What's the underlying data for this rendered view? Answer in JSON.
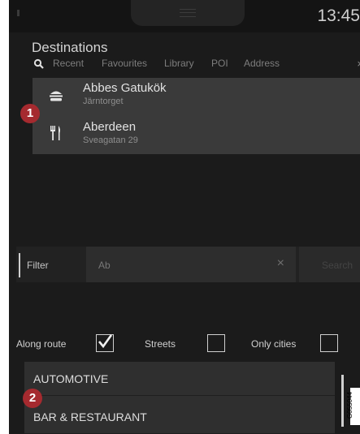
{
  "status": {
    "time": "13:45"
  },
  "header": {
    "title": "Destinations"
  },
  "tabs": [
    {
      "label": "Recent"
    },
    {
      "label": "Favourites"
    },
    {
      "label": "Library"
    },
    {
      "label": "POI"
    },
    {
      "label": "Address"
    }
  ],
  "tabs_close": "×",
  "results": [
    {
      "name": "Abbes Gatukök",
      "sub": "Järntorget",
      "icon": "burger-icon"
    },
    {
      "name": "Aberdeen",
      "sub": "Sveagatan 29",
      "icon": "cutlery-icon"
    }
  ],
  "filter": {
    "label": "Filter",
    "value": "Ab",
    "clear": "×",
    "search_label": "Search"
  },
  "options": {
    "along_route": {
      "label": "Along route",
      "checked": true
    },
    "streets": {
      "label": "Streets",
      "checked": false
    },
    "only_cities": {
      "label": "Only cities",
      "checked": false
    }
  },
  "categories": [
    {
      "label": "AUTOMOTIVE"
    },
    {
      "label": "BAR & RESTAURANT"
    }
  ],
  "callouts": [
    "1",
    "2"
  ],
  "image_code": "G055044",
  "colors": {
    "callout": "#a52a2f",
    "background": "#1b1b1b",
    "panel": "#3a3a3a"
  }
}
